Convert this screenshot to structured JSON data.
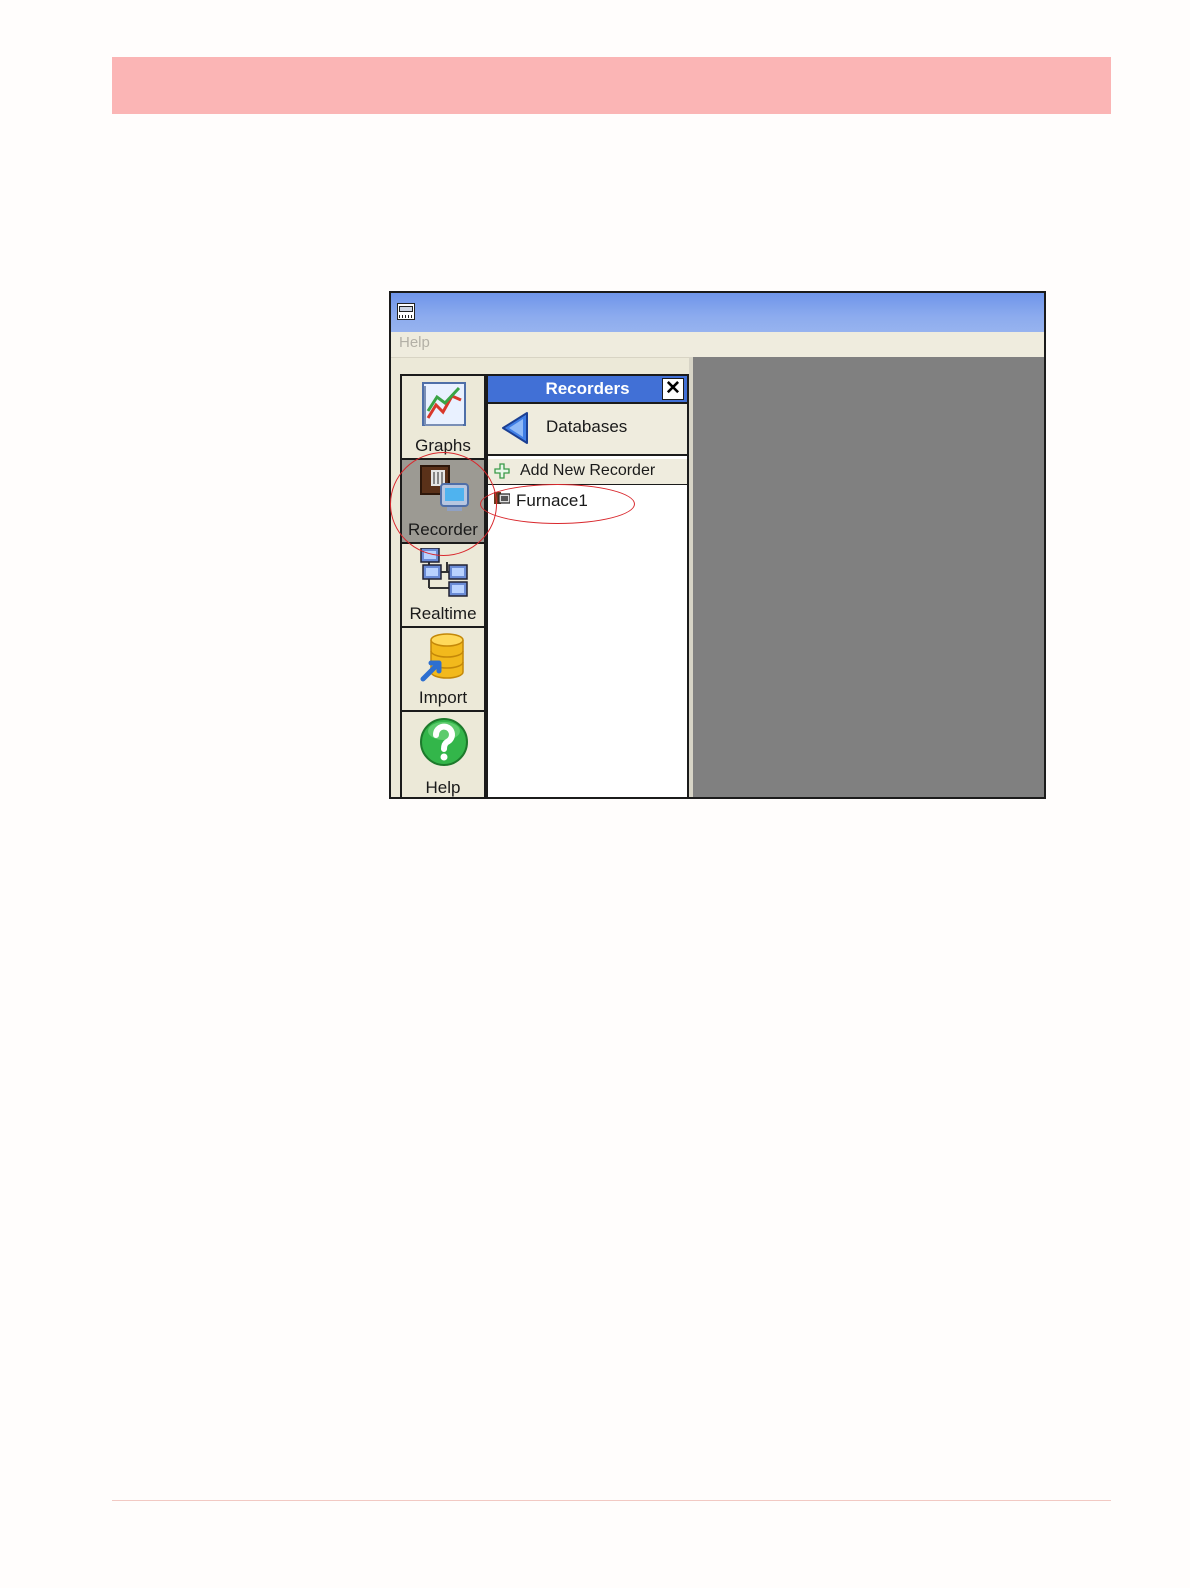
{
  "menu": {
    "help": "Help"
  },
  "toolbar": {
    "items": [
      {
        "label": "Graphs",
        "icon": "graph-icon"
      },
      {
        "label": "Recorder",
        "icon": "recorder-icon",
        "active": true
      },
      {
        "label": "Realtime",
        "icon": "network-icon"
      },
      {
        "label": "Import",
        "icon": "database-import-icon"
      },
      {
        "label": "Help",
        "icon": "help-icon"
      }
    ]
  },
  "recorders_panel": {
    "title": "Recorders",
    "close": "✕",
    "back_label": "Databases",
    "add_label": "Add New Recorder",
    "recorders": [
      {
        "name": "Furnace1"
      }
    ]
  },
  "colors": {
    "header_band": "#fbb5b5",
    "title_bar": "#7fa0ec",
    "panel_header": "#4170d6",
    "workspace": "#808080",
    "highlight": "#d9282d"
  }
}
